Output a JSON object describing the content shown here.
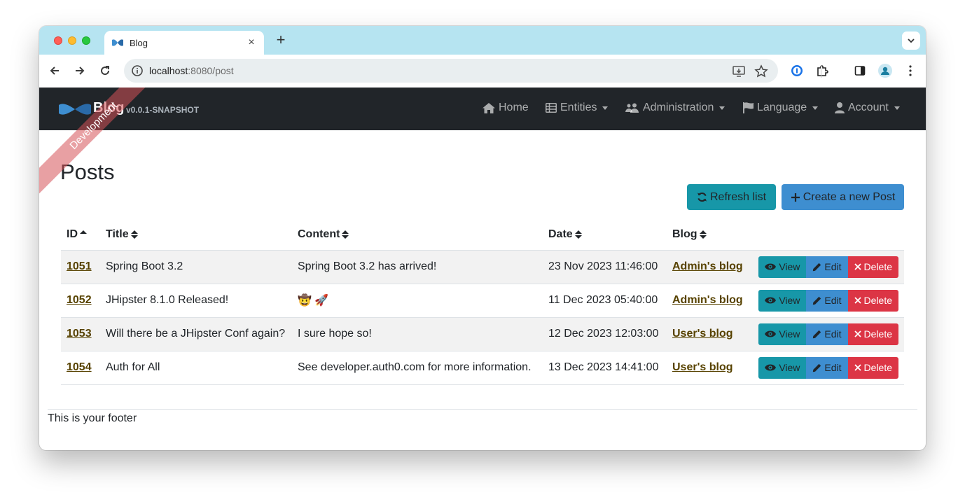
{
  "browser": {
    "tab_title": "Blog",
    "url_host": "localhost",
    "url_rest": ":8080/post"
  },
  "navbar": {
    "brand": "Blog",
    "version": "v0.0.1-SNAPSHOT",
    "ribbon": "Development",
    "items": [
      {
        "label": "Home",
        "icon": "home-icon",
        "dropdown": false
      },
      {
        "label": "Entities",
        "icon": "table-list-icon",
        "dropdown": true
      },
      {
        "label": "Administration",
        "icon": "users-cog-icon",
        "dropdown": true
      },
      {
        "label": "Language",
        "icon": "flag-icon",
        "dropdown": true
      },
      {
        "label": "Account",
        "icon": "user-icon",
        "dropdown": true
      }
    ]
  },
  "page": {
    "title": "Posts",
    "refresh_label": "Refresh list",
    "create_label": "Create a new Post"
  },
  "table": {
    "columns": [
      "ID",
      "Title",
      "Content",
      "Date",
      "Blog"
    ],
    "rows": [
      {
        "id": "1051",
        "title": "Spring Boot 3.2",
        "content": "Spring Boot 3.2 has arrived!",
        "date": "23 Nov 2023 11:46:00",
        "blog": "Admin's blog"
      },
      {
        "id": "1052",
        "title": "JHipster 8.1.0 Released!",
        "content": "🤠 🚀",
        "date": "11 Dec 2023 05:40:00",
        "blog": "Admin's blog"
      },
      {
        "id": "1053",
        "title": "Will there be a JHipster Conf again?",
        "content": "I sure hope so!",
        "date": "12 Dec 2023 12:03:00",
        "blog": "User's blog"
      },
      {
        "id": "1054",
        "title": "Auth for All",
        "content": "See developer.auth0.com for more information.",
        "date": "13 Dec 2023 14:41:00",
        "blog": "User's blog"
      }
    ],
    "actions": {
      "view": "View",
      "edit": "Edit",
      "delete": "Delete"
    }
  },
  "footer": {
    "text": "This is your footer"
  },
  "colors": {
    "tabstrip": "#b6e4f1",
    "navbar": "#212529",
    "info_button": "#1797a8",
    "primary_button": "#3e8ed0",
    "danger_button": "#dc3545",
    "link": "#574200"
  }
}
